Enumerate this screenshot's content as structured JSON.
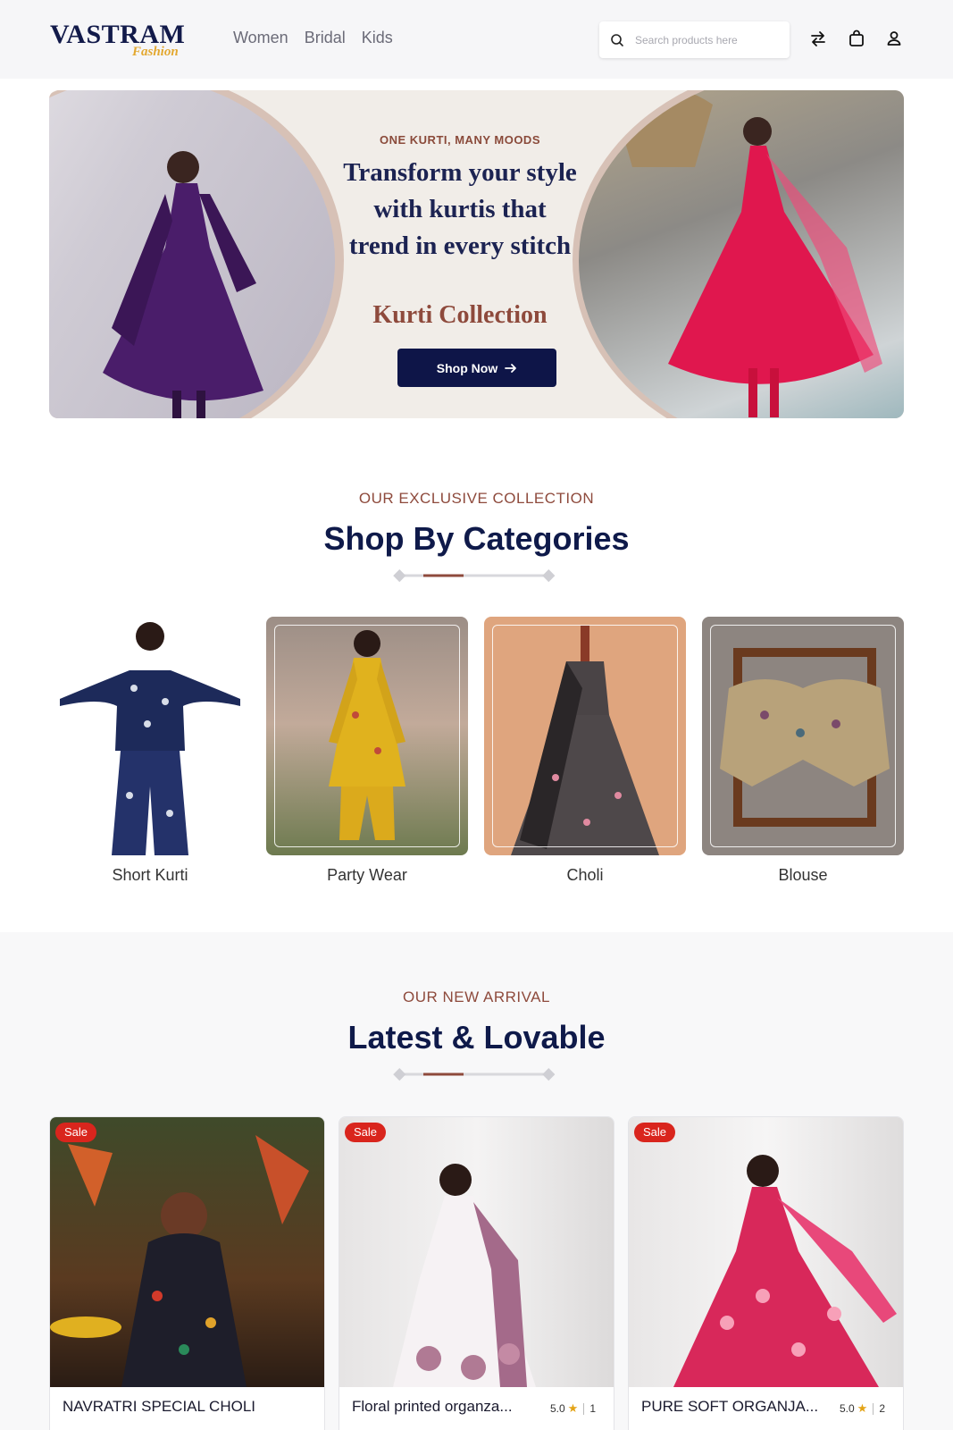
{
  "header": {
    "logo_main": "VASTRAM",
    "logo_sub": "Fashion",
    "nav": [
      "Women",
      "Bridal",
      "Kids"
    ],
    "search_placeholder": "Search products here",
    "icons": [
      "compare-icon",
      "bag-icon",
      "user-icon"
    ]
  },
  "hero": {
    "eyebrow": "ONE KURTI, MANY MOODS",
    "title_lines": [
      "Transform your style",
      "with kurtis that",
      "trend in every stitch"
    ],
    "collection": "Kurti Collection",
    "cta": "Shop Now"
  },
  "categories_section": {
    "eyebrow": "OUR EXCLUSIVE COLLECTION",
    "title": "Shop By Categories",
    "items": [
      {
        "label": "Short Kurti"
      },
      {
        "label": "Party Wear"
      },
      {
        "label": "Choli"
      },
      {
        "label": "Blouse"
      }
    ]
  },
  "arrivals_section": {
    "eyebrow": "OUR NEW ARRIVAL",
    "title": "Latest & Lovable",
    "products": [
      {
        "badge": "Sale",
        "title": "NAVRATRI SPECIAL CHOLI",
        "rating": "",
        "reviews": ""
      },
      {
        "badge": "Sale",
        "title": "Floral printed organza...",
        "rating": "5.0",
        "reviews": "1"
      },
      {
        "badge": "Sale",
        "title": "PURE SOFT ORGANJA...",
        "rating": "5.0",
        "reviews": "2"
      }
    ]
  },
  "colors": {
    "navy": "#0e1548",
    "accent_brown": "#8e4a3c",
    "sale_red": "#d9251d",
    "star_gold": "#e3a316",
    "logo_gold": "#e3a830"
  }
}
